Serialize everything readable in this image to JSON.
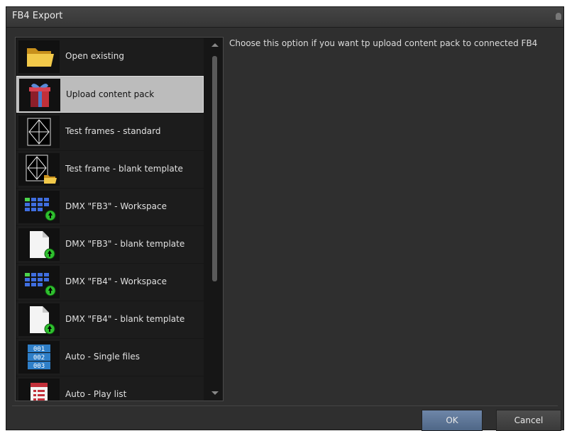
{
  "window": {
    "title": "FB4 Export"
  },
  "list": {
    "items": [
      {
        "label": "Open existing",
        "icon": "folder-icon"
      },
      {
        "label": "Upload content pack",
        "icon": "gift-icon",
        "selected": true
      },
      {
        "label": "Test frames - standard",
        "icon": "test-frame-icon"
      },
      {
        "label": "Test frame - blank template",
        "icon": "test-frame-folder-icon"
      },
      {
        "label": "DMX \"FB3\" - Workspace",
        "icon": "dmx-grid-icon"
      },
      {
        "label": "DMX \"FB3\" - blank template",
        "icon": "blank-document-icon"
      },
      {
        "label": "DMX \"FB4\" - Workspace",
        "icon": "dmx-grid-icon"
      },
      {
        "label": "DMX \"FB4\" - blank template",
        "icon": "blank-document-icon"
      },
      {
        "label": "Auto - Single files",
        "icon": "numbered-files-icon"
      },
      {
        "label": "Auto - Play list",
        "icon": "playlist-icon"
      }
    ]
  },
  "description": "Choose this option if you want tp upload content pack to connected FB4",
  "buttons": {
    "ok": "OK",
    "cancel": "Cancel"
  }
}
